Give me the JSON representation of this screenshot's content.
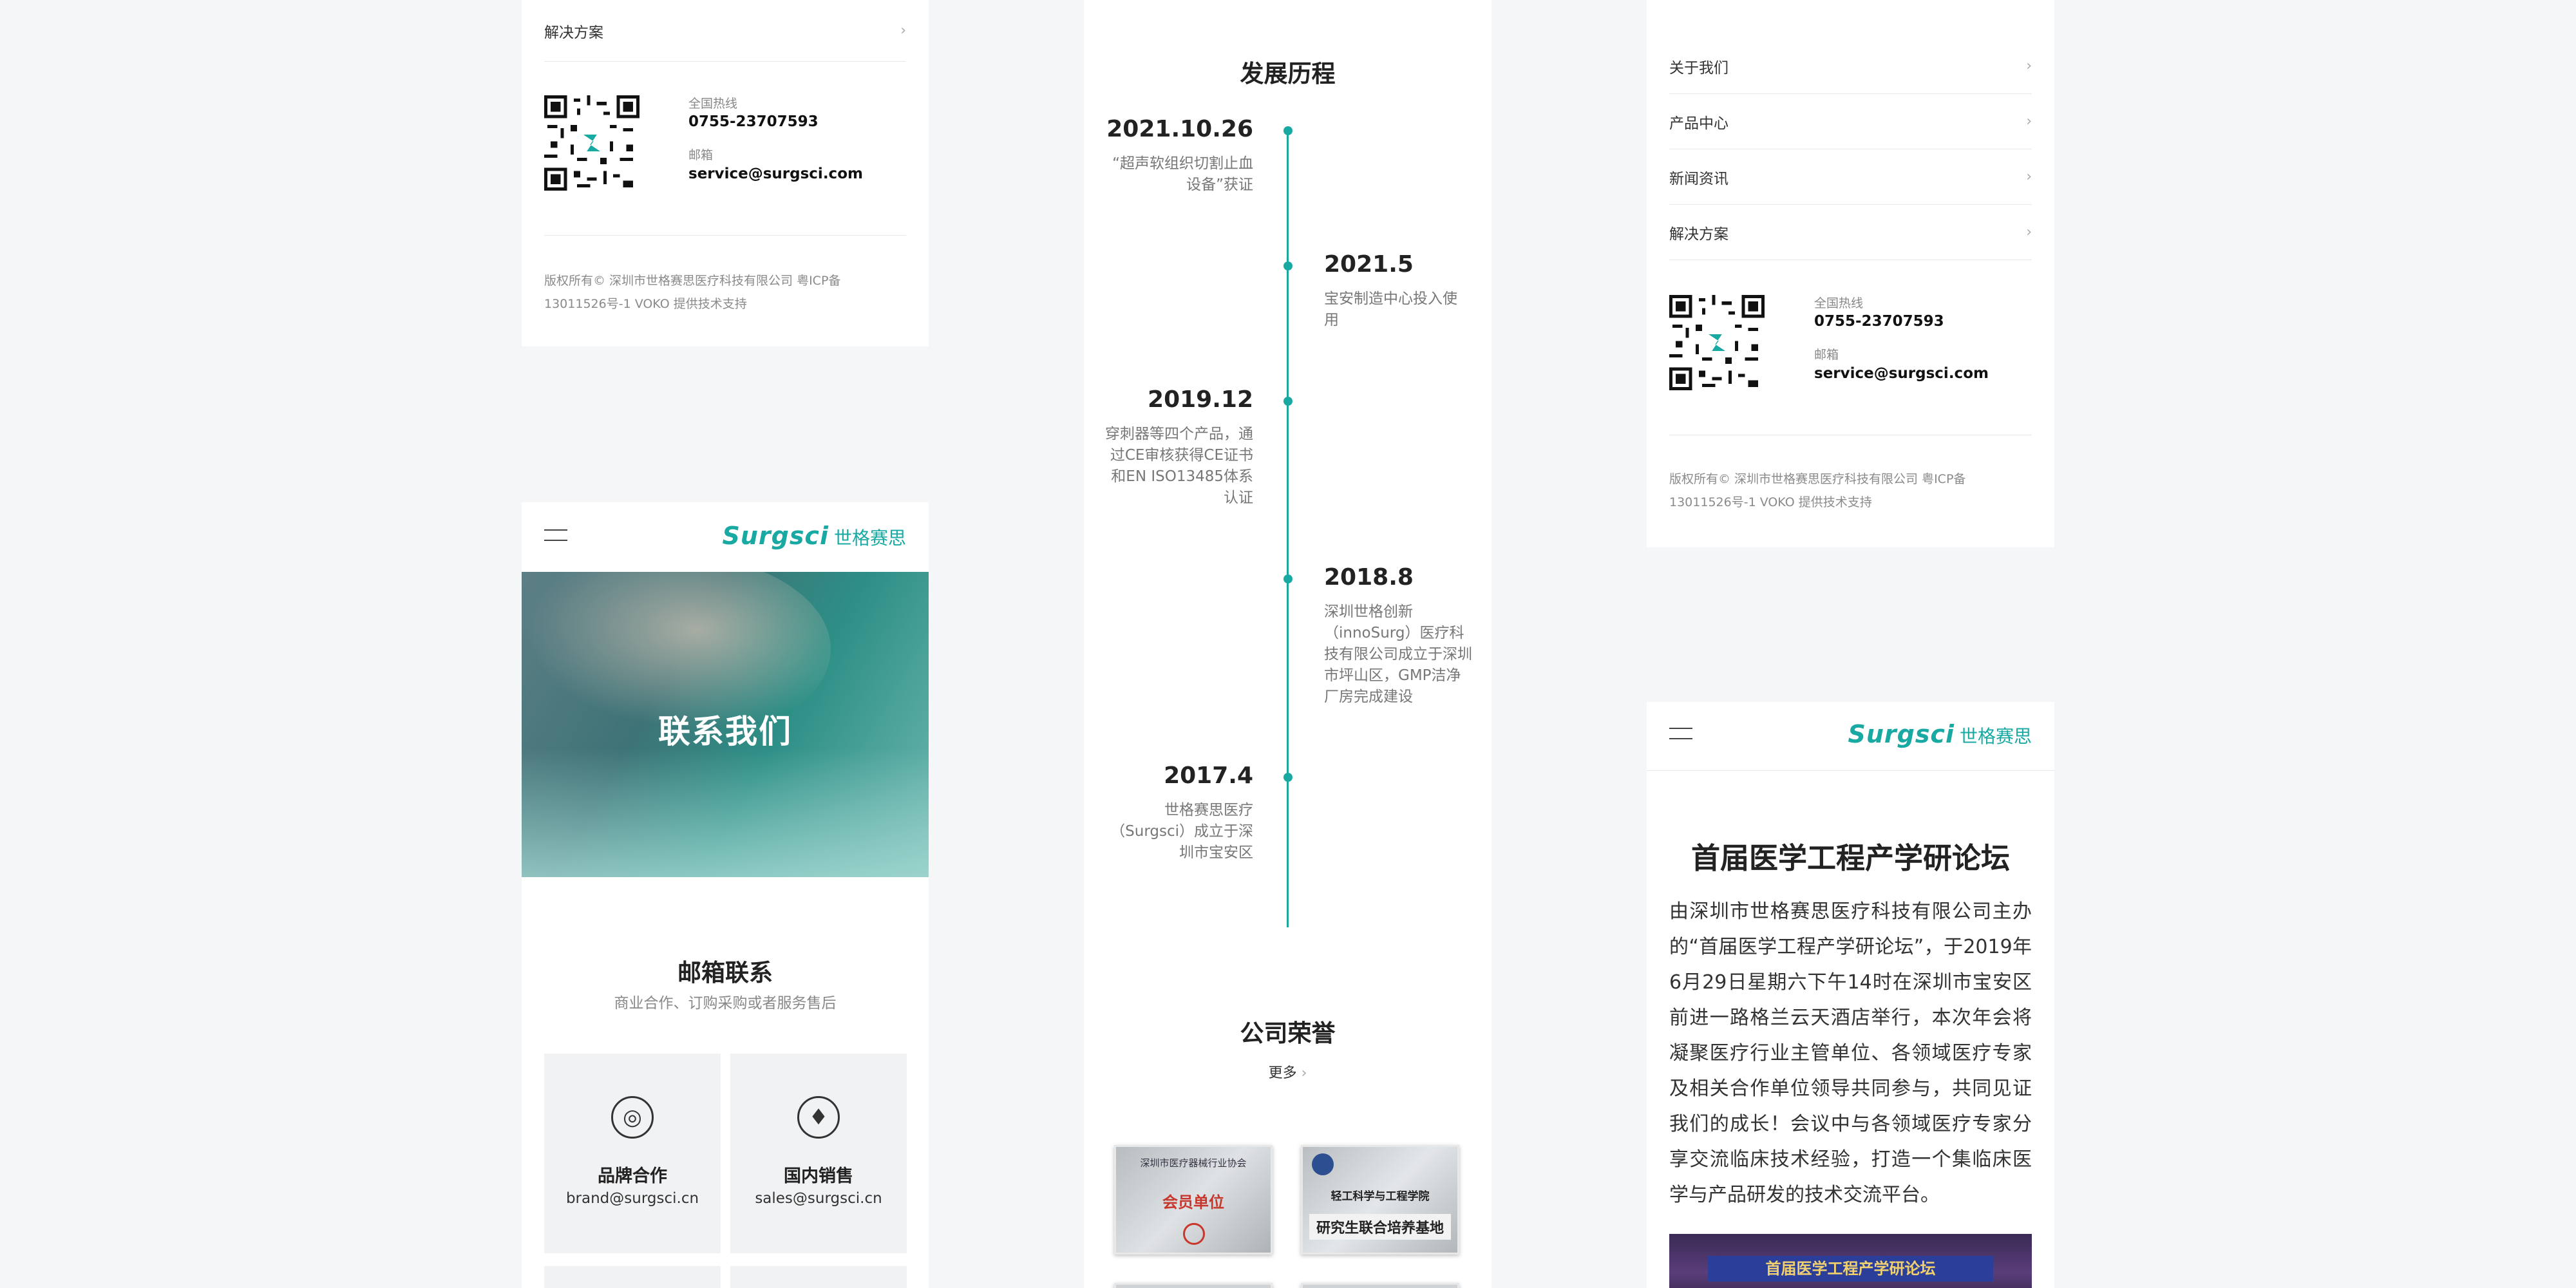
{
  "panel_a": {
    "top_item": "解决方案",
    "hotline_label": "全国热线",
    "hotline": "0755-23707593",
    "email_label": "邮箱",
    "email": "service@surgsci.com",
    "copyright_line1": "版权所有© 深圳市世格赛思医疗科技有限公司 粤ICP备",
    "copyright_line2": "13011526号-1 VOKO 提供技术支持"
  },
  "contact_page": {
    "logo_en": "Surgsci",
    "logo_cn": "世格赛思",
    "banner_title": "联系我们",
    "mail_title": "邮箱联系",
    "mail_subtitle": "商业合作、订购采购或者服务售后",
    "mail_boxes": [
      {
        "icon": "target-icon",
        "title": "品牌合作",
        "email": "brand@surgsci.cn"
      },
      {
        "icon": "tie-icon",
        "title": "国内销售",
        "email": "sales@surgsci.cn"
      }
    ]
  },
  "history": {
    "title": "发展历程",
    "events": [
      {
        "year": "2021.10.26",
        "desc": "“超声软组织切割止血设备”获证"
      },
      {
        "year": "2021.5",
        "desc": "宝安制造中心投入使用"
      },
      {
        "year": "2019.12",
        "desc": "穿刺器等四个产品，通过CE审核获得CE证书和EN ISO13485体系认证"
      },
      {
        "year": "2018.8",
        "desc": "深圳世格创新（innoSurg）医疗科技有限公司成立于深圳市坪山区，GMP洁净厂房完成建设"
      },
      {
        "year": "2017.4",
        "desc": "世格赛思医疗（Surgsci）成立于深圳市宝安区"
      }
    ],
    "honors_title": "公司荣誉",
    "more": "更多",
    "honors": [
      {
        "line1": "深圳市医疗器械行业协会",
        "line2": "会员单位"
      },
      {
        "line1": "轻工科学与工程学院",
        "line2": "研究生联合培养基地"
      }
    ]
  },
  "panel_c": {
    "menu": [
      "关于我们",
      "产品中心",
      "新闻资讯",
      "解决方案"
    ],
    "hotline_label": "全国热线",
    "hotline": "0755-23707593",
    "email_label": "邮箱",
    "email": "service@surgsci.com",
    "copyright_line1": "版权所有© 深圳市世格赛思医疗科技有限公司 粤ICP备",
    "copyright_line2": "13011526号-1 VOKO 提供技术支持"
  },
  "news_page": {
    "logo_en": "Surgsci",
    "logo_cn": "世格赛思",
    "title": "首届医学工程产学研论坛",
    "body": "由深圳市世格赛思医疗科技有限公司主办的“首届医学工程产学研论坛”，于2019年6月29日星期六下午14时在深圳市宝安区前进一路格兰云天酒店举行，本次年会将凝聚医疗行业主管单位、各领域医疗专家及相关合作单位领导共同参与，共同见证我们的成长！会议中与各领域医疗专家分享交流临床技术经验，打造一个集临床医学与产品研发的技术交流平台。",
    "photo_banner": "首届医学工程产学研论坛"
  },
  "colors": {
    "accent": "#18a9a3",
    "background": "#f5f6f8"
  }
}
